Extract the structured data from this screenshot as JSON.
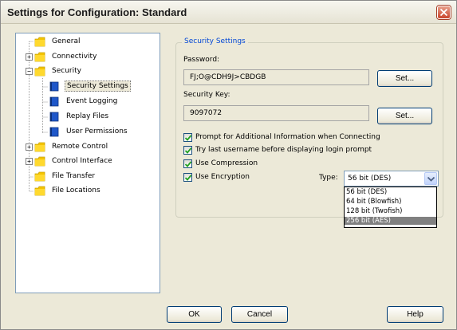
{
  "window": {
    "title": "Settings for Configuration: Standard"
  },
  "tree": {
    "items": [
      {
        "label": "General",
        "icon": "folder-icon"
      },
      {
        "label": "Connectivity",
        "icon": "folder-icon",
        "expander": "+"
      },
      {
        "label": "Security",
        "icon": "folder-icon",
        "expander": "−"
      },
      {
        "label": "Security Settings",
        "icon": "book-icon",
        "selected": true
      },
      {
        "label": "Event Logging",
        "icon": "book-icon"
      },
      {
        "label": "Replay Files",
        "icon": "book-icon"
      },
      {
        "label": "User Permissions",
        "icon": "book-icon"
      },
      {
        "label": "Remote Control",
        "icon": "folder-icon",
        "expander": "+"
      },
      {
        "label": "Control Interface",
        "icon": "folder-icon",
        "expander": "+"
      },
      {
        "label": "File Transfer",
        "icon": "folder-icon"
      },
      {
        "label": "File Locations",
        "icon": "folder-icon"
      }
    ]
  },
  "security": {
    "group_title": "Security Settings",
    "password_label": "Password:",
    "password_value": "FJ;O@CDH9J>CBDGB",
    "password_set": "Set...",
    "key_label": "Security Key:",
    "key_value": "9097072",
    "key_set": "Set...",
    "checkboxes": [
      {
        "label": "Prompt for Additional Information when Connecting",
        "checked": true
      },
      {
        "label": "Try last username before displaying login prompt",
        "checked": true
      },
      {
        "label": "Use Compression",
        "checked": true
      },
      {
        "label": "Use Encryption",
        "checked": true
      }
    ],
    "type_label": "Type:",
    "type_selected": "56 bit (DES)",
    "type_options": [
      "56 bit (DES)",
      "64 bit (Blowfish)",
      "128 bit (Twofish)",
      "256 bit (AES)"
    ],
    "type_highlighted": "256 bit (AES)"
  },
  "footer": {
    "ok": "OK",
    "cancel": "Cancel",
    "help": "Help"
  },
  "colors": {
    "accent": "#0046d5",
    "close": "#c9452c",
    "folder": "#f5c400",
    "book": "#1f57c9"
  }
}
